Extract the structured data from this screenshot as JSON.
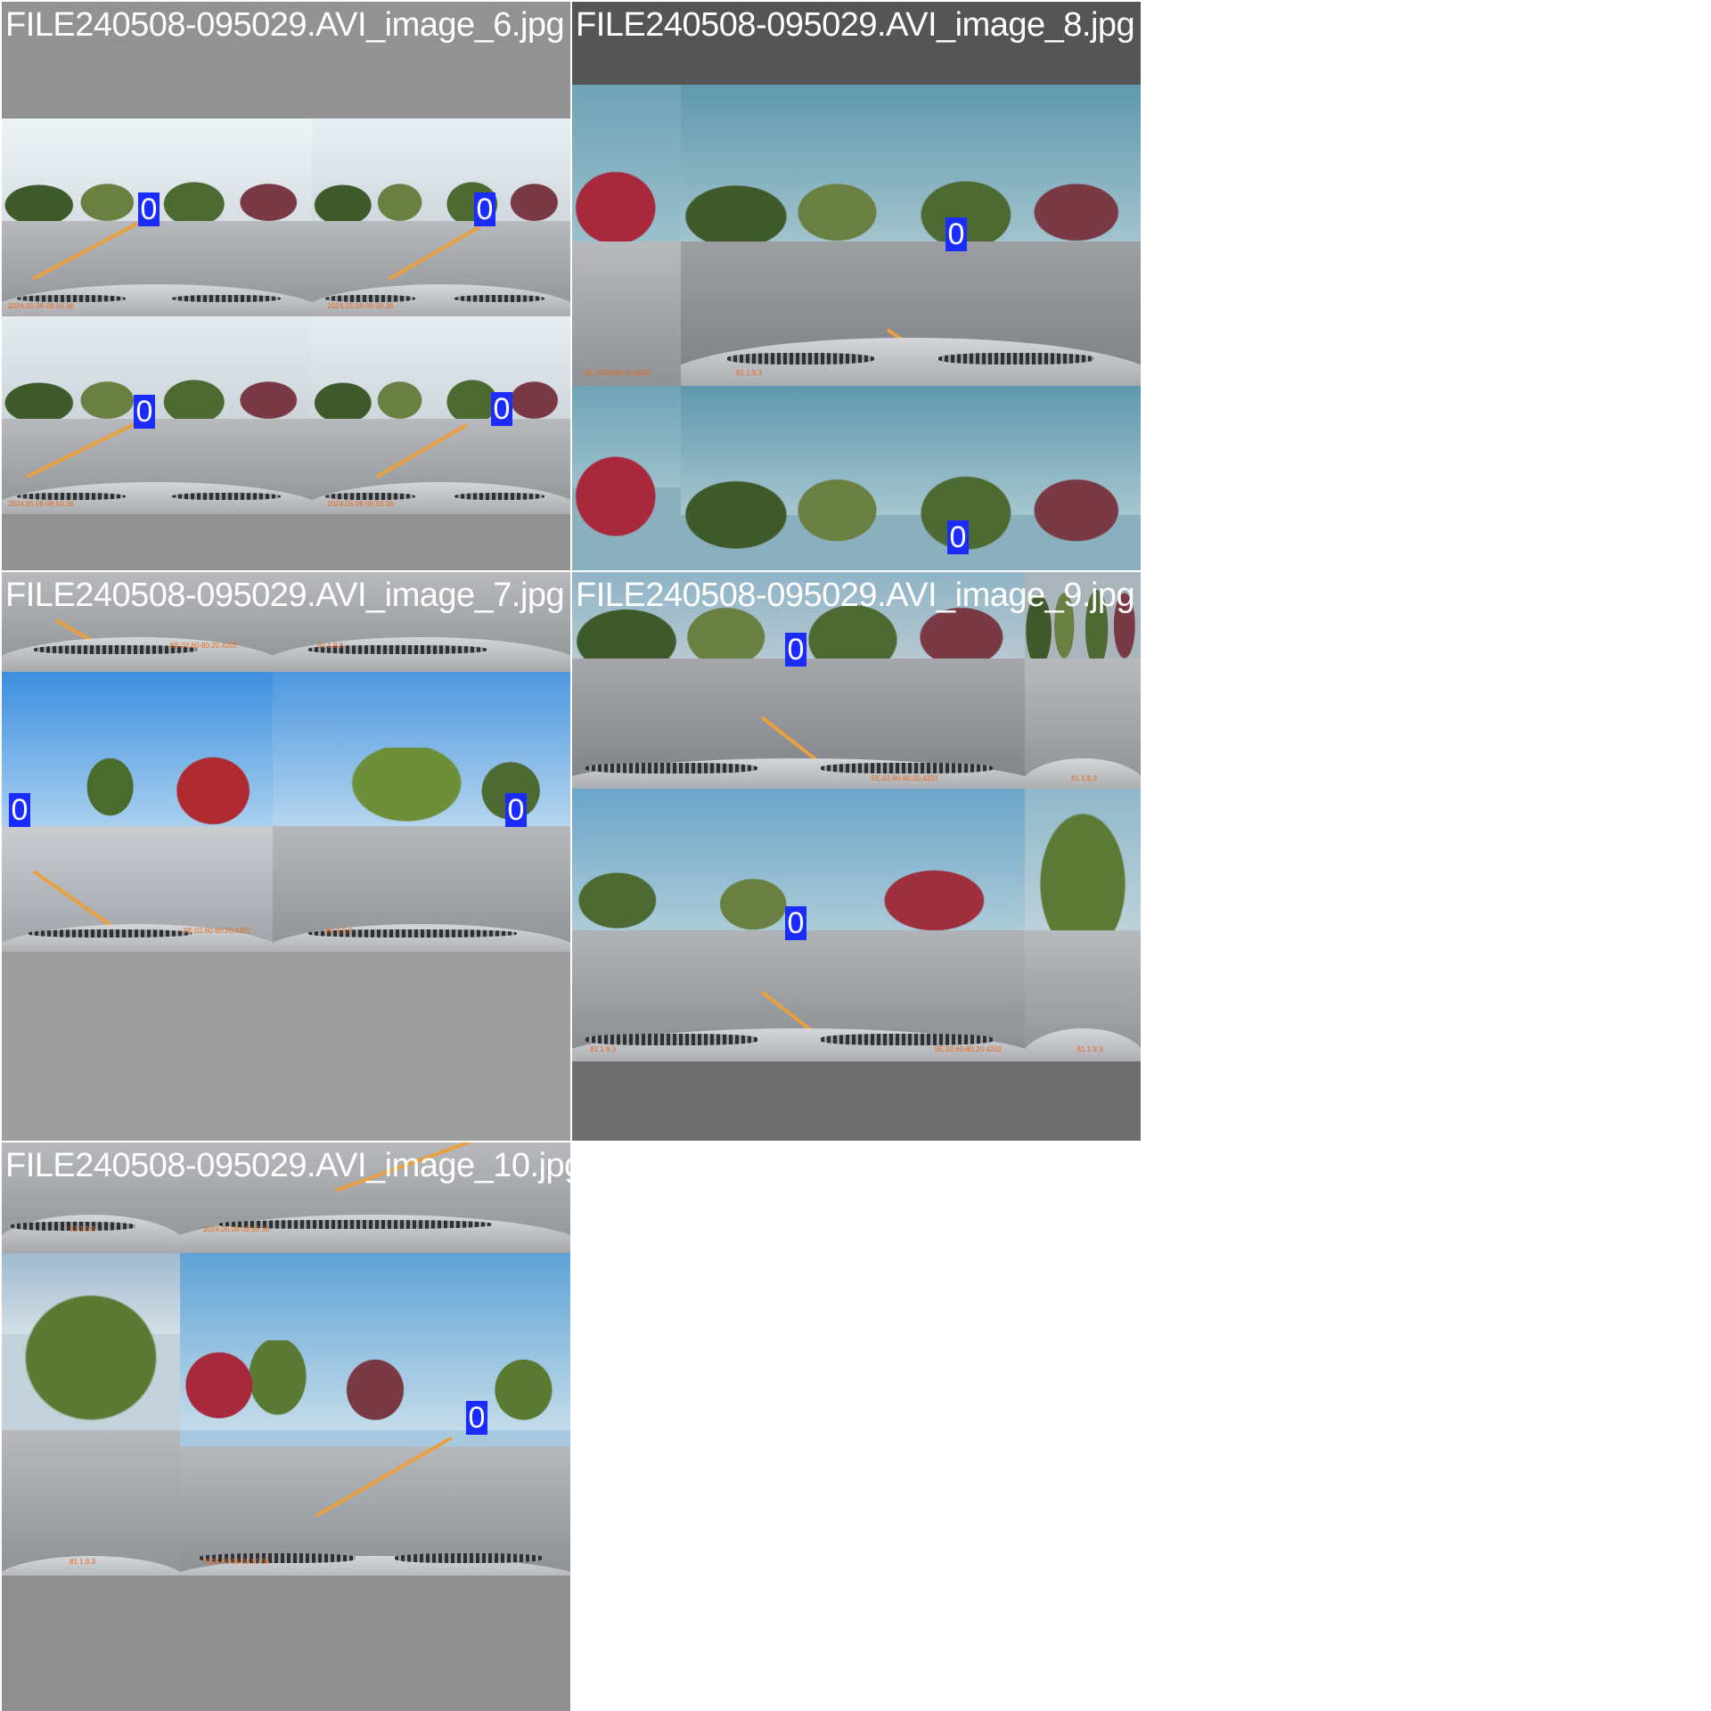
{
  "tiles": [
    {
      "title": "FILE240508-095029.AVI_image_6.jpg",
      "bg": "#929292"
    },
    {
      "title": "FILE240508-095029.AVI_image_8.jpg",
      "bg": "#555555"
    },
    {
      "title": "FILE240508-095029.AVI_image_7.jpg",
      "bg": "#9e9e9e"
    },
    {
      "title": "FILE240508-095029.AVI_image_9.jpg",
      "bg": "#6e6e6e"
    },
    {
      "title": "FILE240508-095029.AVI_image_10.jpg",
      "bg": "#8f8f8f"
    }
  ],
  "label": "0",
  "stamps": {
    "date": "2024.05.08-09.50.36",
    "date_mirrored": "SE.02.60-80.20.4202",
    "speed": "81 1.9.3"
  },
  "colors": {
    "box": "#1a2cff",
    "lane": "#e8a040",
    "page": "#ffffff"
  }
}
